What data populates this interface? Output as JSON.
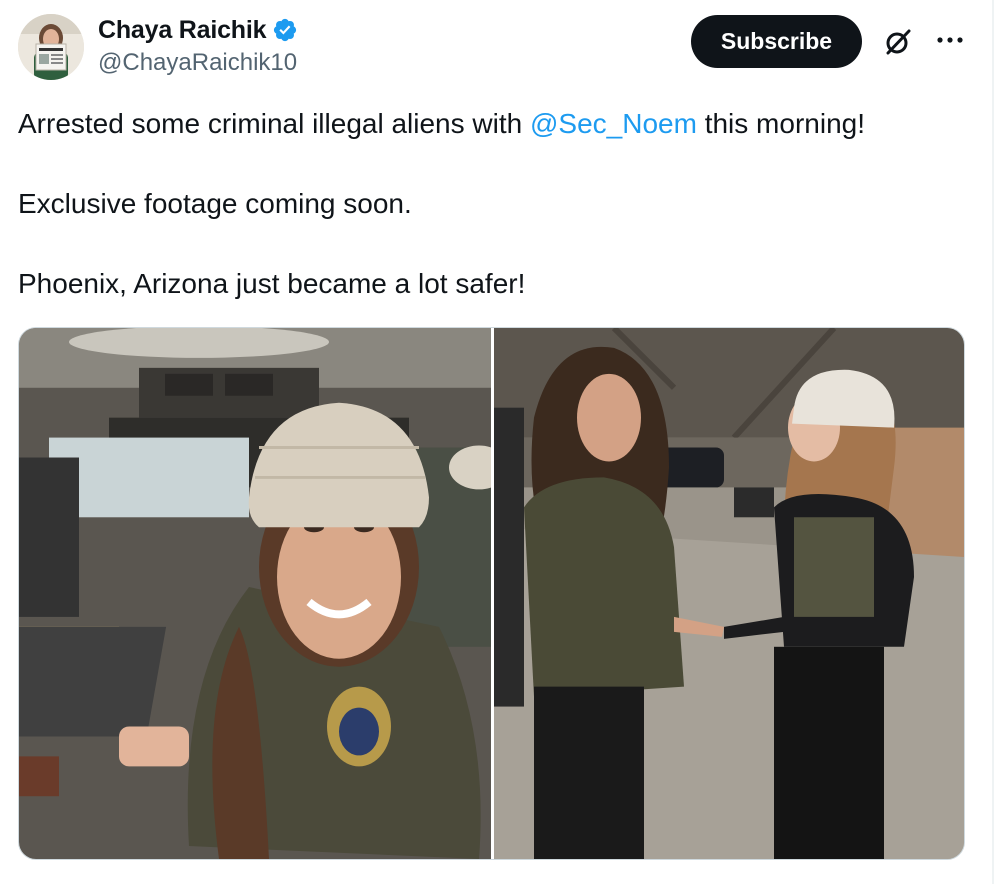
{
  "author": {
    "display_name": "Chaya Raichik",
    "handle": "@ChayaRaichik10",
    "verified": true
  },
  "actions": {
    "subscribe_label": "Subscribe",
    "grok_icon": "grok-slash-circle-icon",
    "more_icon": "more-horizontal-icon"
  },
  "tweet": {
    "line1_before": "Arrested some criminal illegal aliens with ",
    "mention": "@Sec_Noem",
    "line1_after": " this morning!",
    "line2": "Exclusive footage coming soon.",
    "line3": "Phoenix, Arizona just became a lot safer!"
  },
  "media": {
    "count": 2
  },
  "colors": {
    "link": "#1d9bf0",
    "text": "#0f1419",
    "secondary": "#536471",
    "button_bg": "#0f1419",
    "verified_badge": "#1d9bf0"
  }
}
